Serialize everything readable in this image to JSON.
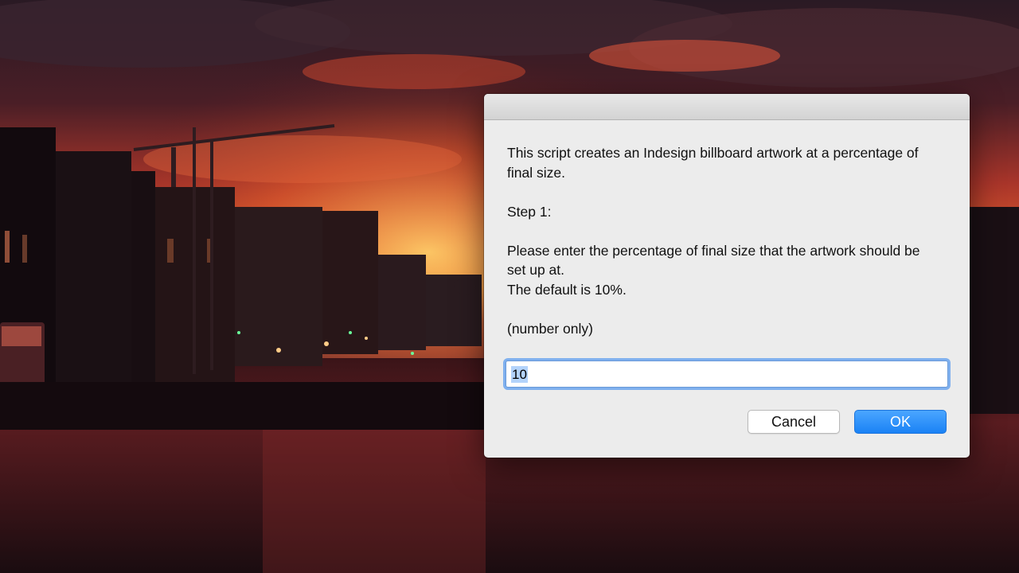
{
  "dialog": {
    "message": {
      "intro": "This script creates an Indesign billboard artwork at a percentage of final size.",
      "step": "Step 1:",
      "instruction_line1": "Please enter the percentage of final size that the artwork should be set up at.",
      "instruction_line2": "The default is 10%.",
      "note": "(number only)"
    },
    "input": {
      "value": "10"
    },
    "buttons": {
      "cancel_label": "Cancel",
      "ok_label": "OK"
    }
  },
  "colors": {
    "accent": "#1a82f5",
    "dialog_bg": "#ececec",
    "focus_ring": "#7fb0ee"
  }
}
